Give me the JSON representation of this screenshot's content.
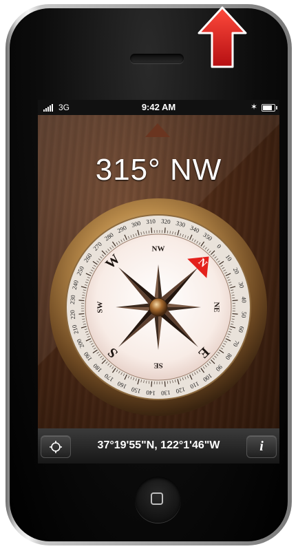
{
  "status_bar": {
    "carrier": "3G",
    "time": "9:42 AM"
  },
  "compass": {
    "heading_text": "315° NW",
    "heading_degrees": 315,
    "cardinal_labels": {
      "N": "N",
      "NE": "NE",
      "E": "E",
      "SE": "SE",
      "S": "S",
      "SW": "SW",
      "W": "W",
      "NW": "NW"
    },
    "degree_labels": [
      "0",
      "10",
      "20",
      "30",
      "40",
      "50",
      "60",
      "70",
      "80",
      "90",
      "100",
      "110",
      "120",
      "130",
      "140",
      "150",
      "160",
      "170",
      "180",
      "190",
      "200",
      "210",
      "220",
      "230",
      "240",
      "250",
      "260",
      "270",
      "280",
      "290",
      "300",
      "310",
      "320",
      "330",
      "340",
      "350"
    ]
  },
  "toolbar": {
    "coordinates": "37°19'55\"N, 122°1'46\"W",
    "info_label": "i"
  },
  "colors": {
    "arrow": "#e0191c",
    "north_marker": "#e4211c",
    "wood": "#4a2815"
  },
  "icons": [
    "signal-icon",
    "bluetooth-icon",
    "battery-icon",
    "location-icon",
    "info-icon",
    "home-button-icon",
    "up-arrow-icon"
  ]
}
